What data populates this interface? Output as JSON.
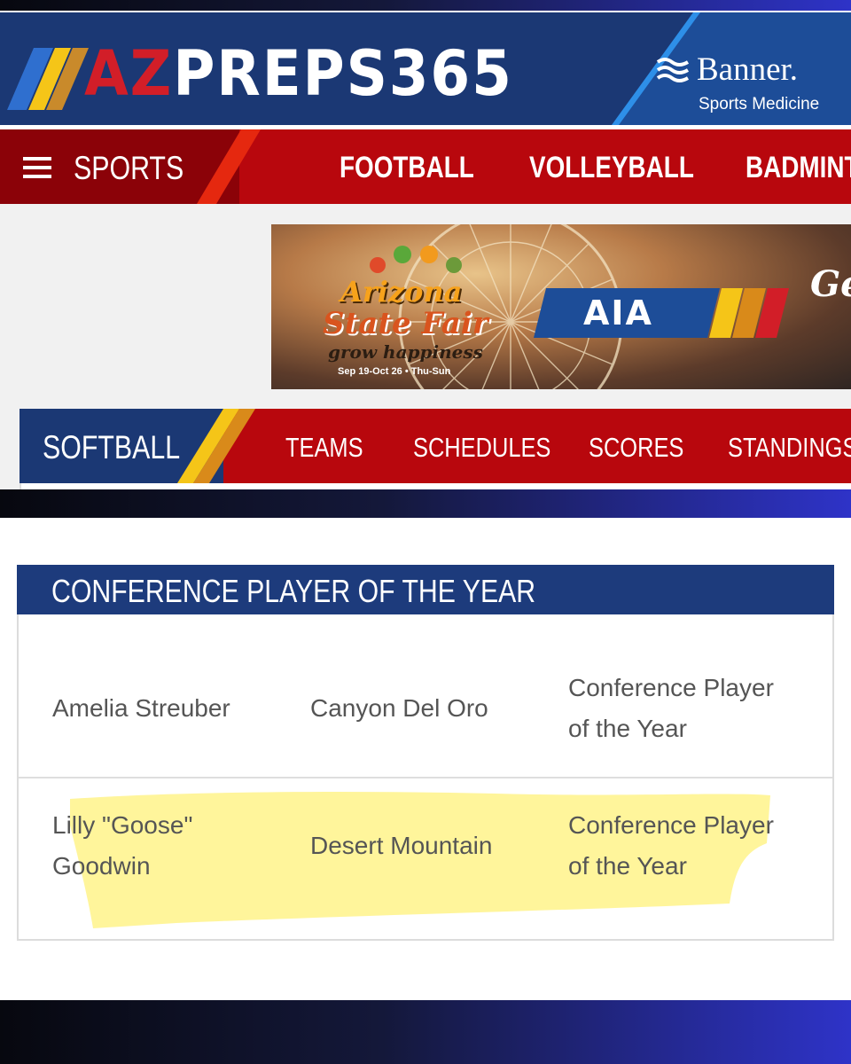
{
  "header": {
    "logo_az": "AZ",
    "logo_rest": "PREPS365",
    "sponsor_name": "Banner.",
    "sponsor_sub": "Sports Medicine"
  },
  "sports_nav": {
    "menu_label": "SPORTS",
    "items": [
      "FOOTBALL",
      "VOLLEYBALL",
      "BADMINT"
    ]
  },
  "ad": {
    "title_line1": "Arizona",
    "title_line2": "State Fair",
    "tagline": "grow happiness",
    "dates": "Sep 19-Oct 26 • Thu-Sun",
    "partner": "AIA",
    "cut_text": "Ge"
  },
  "sport_nav": {
    "sport": "SOFTBALL",
    "tabs": [
      "TEAMS",
      "SCHEDULES",
      "SCORES",
      "STANDINGS"
    ]
  },
  "award": {
    "title": "CONFERENCE PLAYER OF THE YEAR",
    "rows": [
      {
        "player": "Amelia Streuber",
        "school": "Canyon Del Oro",
        "award_line1": "Conference Player",
        "award_line2": "of the Year"
      },
      {
        "player_line1": "Lilly \"Goose\"",
        "player_line2": "Goodwin",
        "school": "Desert Mountain",
        "award_line1": "Conference Player",
        "award_line2": "of the Year"
      }
    ]
  },
  "colors": {
    "navy": "#1b3874",
    "red": "#b8070d",
    "dark_red": "#8b0208",
    "gold": "#f5c518",
    "highlight": "#fff38a"
  }
}
